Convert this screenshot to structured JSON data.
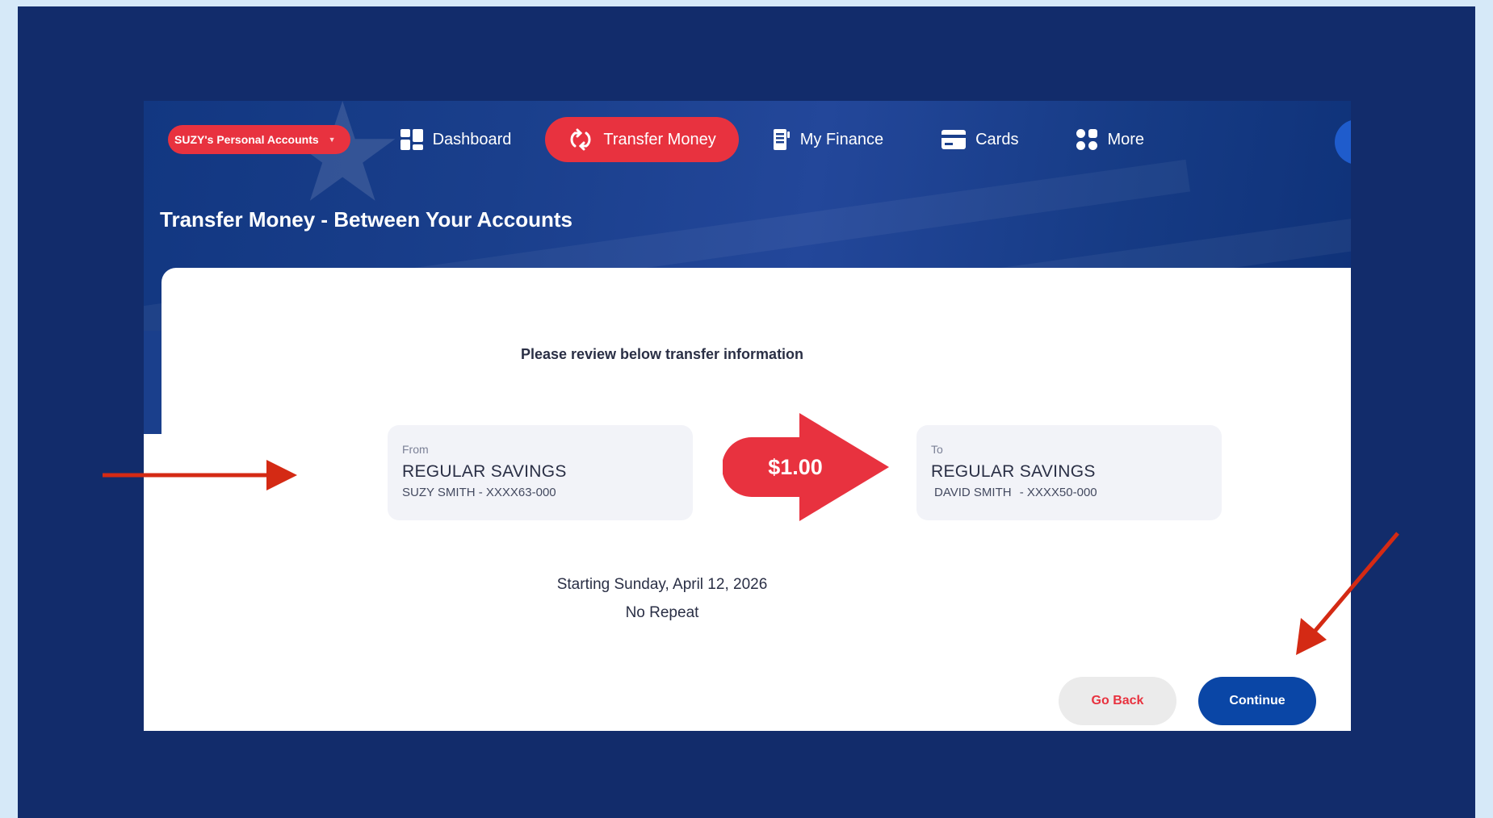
{
  "nav": {
    "account_switcher": "SUZY's Personal Accounts",
    "items": [
      {
        "label": "Dashboard",
        "icon": "dashboard-icon",
        "active": false
      },
      {
        "label": "Transfer Money",
        "icon": "transfer-icon",
        "active": true
      },
      {
        "label": "My Finance",
        "icon": "finance-icon",
        "active": false
      },
      {
        "label": "Cards",
        "icon": "card-icon",
        "active": false
      },
      {
        "label": "More",
        "icon": "more-icon",
        "active": false
      }
    ]
  },
  "page": {
    "title": "Transfer Money - Between Your Accounts"
  },
  "review": {
    "instruction": "Please review below transfer information",
    "from": {
      "label": "From",
      "account_name": "REGULAR SAVINGS",
      "owner": "SUZY SMITH",
      "account_number": "- XXXX63-000"
    },
    "amount": "$1.00",
    "to": {
      "label": "To",
      "account_name": "REGULAR SAVINGS",
      "owner": "DAVID SMITH",
      "account_number": "- XXXX50-000"
    },
    "schedule_start": "Starting Sunday, April 12, 2026",
    "schedule_repeat": "No Repeat"
  },
  "actions": {
    "go_back": "Go Back",
    "continue": "Continue"
  },
  "colors": {
    "frame_bg": "#122c6b",
    "header_bg": "#1a3f8c",
    "accent_red": "#e8323f",
    "primary_blue": "#0a46a6",
    "annotation_red": "#d42a14"
  }
}
